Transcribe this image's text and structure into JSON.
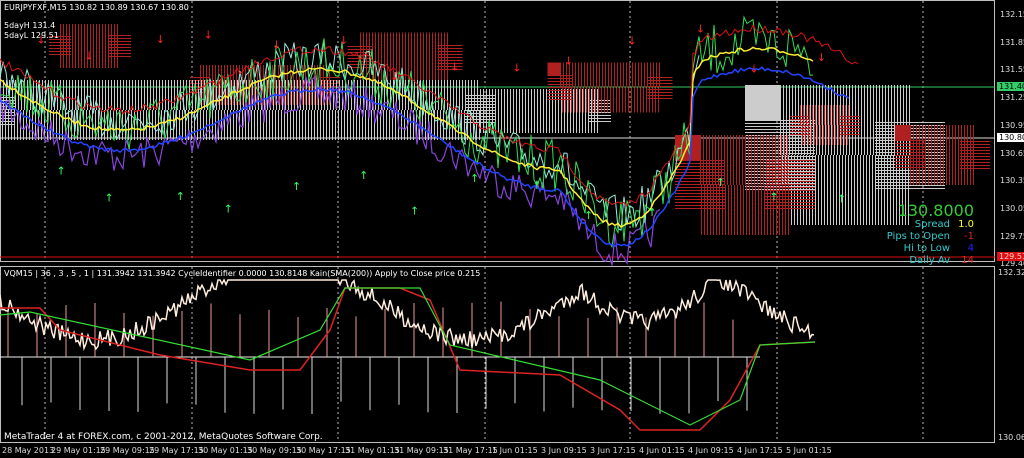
{
  "chart": {
    "symbol_line": "EURJPYFXF,M15  130.82 130.89 130.67 130.80",
    "day_high": "5dayH 131.4",
    "day_low": "5dayL 129.51"
  },
  "price_axis": {
    "ticks": [
      "132.15",
      "131.85",
      "131.55",
      "131.25",
      "130.95",
      "130.65",
      "130.35",
      "130.05",
      "129.75",
      "129.46"
    ],
    "tag_high": "131.40",
    "tag_current": "130.80",
    "tag_low": "129.51",
    "colors": {
      "high": "#33cc66",
      "current": "#ffffff",
      "low": "#dd1111"
    }
  },
  "info_panel": {
    "price": "130.8000",
    "rows": [
      {
        "label": "Spread",
        "value": "1.0",
        "color": "#ffff33"
      },
      {
        "label": "Pips to Open",
        "value": "-1",
        "color": "#dd2222"
      },
      {
        "label": "Hi to Low",
        "value": "4",
        "color": "#2222ff"
      },
      {
        "label": "Daily Av",
        "value": "14",
        "color": "#dd2222"
      }
    ]
  },
  "indicator": {
    "label": "VQM15 | 36 , 3 , 5 , 1  |  131.3942 131.3942  CycleIdentifier 0.0000 130.8148  Kain(SMA(200)) Apply to Close price 0.215",
    "axis_top": "132.324",
    "axis_bottom": "130.063"
  },
  "footer": "MetaTrader 4 at FOREX.com, c 2001-2012, MetaQuotes Software Corp.",
  "time_axis": [
    "28 May 2013",
    "29 May 01:15",
    "29 May 09:15",
    "29 May 17:15",
    "30 May 01:15",
    "30 May 09:15",
    "30 May 17:15",
    "31 May 01:15",
    "31 May 09:15",
    "31 May 17:15",
    "1 Jun 01:15",
    "3 Jun 09:15",
    "3 Jun 17:15",
    "4 Jun 01:15",
    "4 Jun 09:15",
    "4 Jun 17:15",
    "5 Jun 01:15"
  ]
}
